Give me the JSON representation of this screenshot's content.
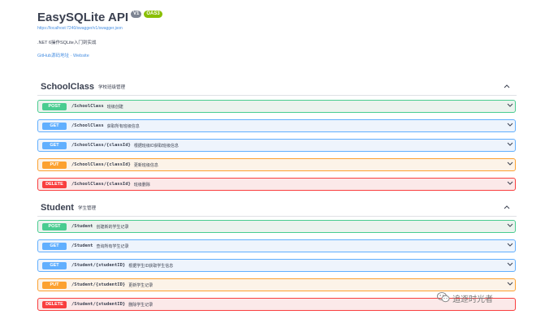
{
  "info": {
    "title": "EasySQLite API",
    "version_badge": "V1",
    "oas_badge": "OAS3",
    "spec_url": "https://localhost:7240/swagger/v1/swagger.json",
    "description": ".NET 6操作SQLite入门到实战",
    "links": "GitHub源码地址 · Website"
  },
  "sections": [
    {
      "name": "SchoolClass",
      "description": "学校班级管理",
      "operations": [
        {
          "method": "POST",
          "path": "/SchoolClass",
          "summary": "班级创建"
        },
        {
          "method": "GET",
          "path": "/SchoolClass",
          "summary": "获取所有班级信息"
        },
        {
          "method": "GET",
          "path": "/SchoolClass/{classId}",
          "summary": "根据班级ID获取班级信息"
        },
        {
          "method": "PUT",
          "path": "/SchoolClass/{classId}",
          "summary": "更新班级信息"
        },
        {
          "method": "DELETE",
          "path": "/SchoolClass/{classId}",
          "summary": "班级删除"
        }
      ]
    },
    {
      "name": "Student",
      "description": "学生管理",
      "operations": [
        {
          "method": "POST",
          "path": "/Student",
          "summary": "创建新的学生记录"
        },
        {
          "method": "GET",
          "path": "/Student",
          "summary": "查询所有学生记录"
        },
        {
          "method": "GET",
          "path": "/Student/{studentID}",
          "summary": "根据学生ID获取学生信息"
        },
        {
          "method": "PUT",
          "path": "/Student/{studentID}",
          "summary": "更新学生记录"
        },
        {
          "method": "DELETE",
          "path": "/Student/{studentID}",
          "summary": "删除学生记录"
        }
      ]
    }
  ],
  "watermark": "追逐时光者",
  "colors": {
    "post": "#49cc90",
    "get": "#61affe",
    "put": "#fca130",
    "delete": "#f93e3e"
  }
}
